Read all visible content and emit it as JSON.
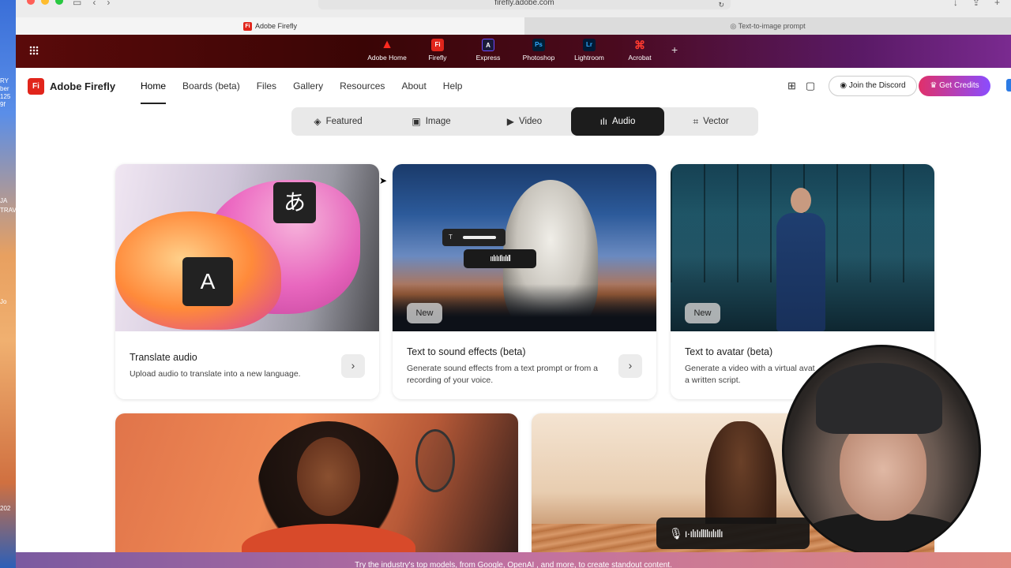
{
  "browser": {
    "url": "firefly.adobe.com",
    "tabs": [
      {
        "label": "Adobe Firefly",
        "active": true
      },
      {
        "label": "Text-to-image prompt",
        "active": false
      }
    ]
  },
  "appbar": {
    "apps": [
      {
        "label": "Adobe Home",
        "icon": "adobe-home-icon",
        "glyph": "A"
      },
      {
        "label": "Firefly",
        "icon": "firefly-icon",
        "glyph": "Fi"
      },
      {
        "label": "Express",
        "icon": "express-icon",
        "glyph": "A"
      },
      {
        "label": "Photoshop",
        "icon": "photoshop-icon",
        "glyph": "Ps"
      },
      {
        "label": "Lightroom",
        "icon": "lightroom-icon",
        "glyph": "Lr"
      },
      {
        "label": "Acrobat",
        "icon": "acrobat-icon",
        "glyph": "A"
      }
    ],
    "add_glyph": "+"
  },
  "header": {
    "logo_glyph": "Fi",
    "logo_text": "Adobe Firefly",
    "nav": [
      "Home",
      "Boards (beta)",
      "Files",
      "Gallery",
      "Resources",
      "About",
      "Help"
    ],
    "active_nav": "Home",
    "discord_label": "Join the Discord",
    "credits_label": "Get Credits"
  },
  "category_tabs": {
    "items": [
      "Featured",
      "Image",
      "Video",
      "Audio",
      "Vector"
    ],
    "active": "Audio"
  },
  "cards": [
    {
      "title": "Translate audio",
      "desc": "Upload audio to translate into a new language.",
      "badge": "",
      "glyph_a": "A",
      "glyph_b": "あ"
    },
    {
      "title": "Text to sound effects (beta)",
      "desc": "Generate sound effects from a text prompt or from a recording of your voice.",
      "badge": "New",
      "chip_t": "T",
      "chip_wave": "ıılıIıIlıılıll"
    },
    {
      "title": "Text to avatar (beta)",
      "desc": "Generate a video with a virtual avat",
      "desc2": "a written script.",
      "badge": "New"
    }
  ],
  "row2": {
    "voice_wave": "🎙 ı·ılıIıllIlıılıIlı"
  },
  "promo": {
    "text": "Try the industry's top models, from Google, OpenAI , and more, to create standout content."
  },
  "desktop_labels": [
    "RY",
    "ber",
    "125",
    "9f",
    "JA",
    "TRAV",
    "Jo",
    "202"
  ],
  "colors": {
    "accent_red": "#e1251b",
    "active_tab": "#1c1c1c",
    "credits_gradient_start": "#e0306a",
    "credits_gradient_end": "#8a4dff"
  }
}
